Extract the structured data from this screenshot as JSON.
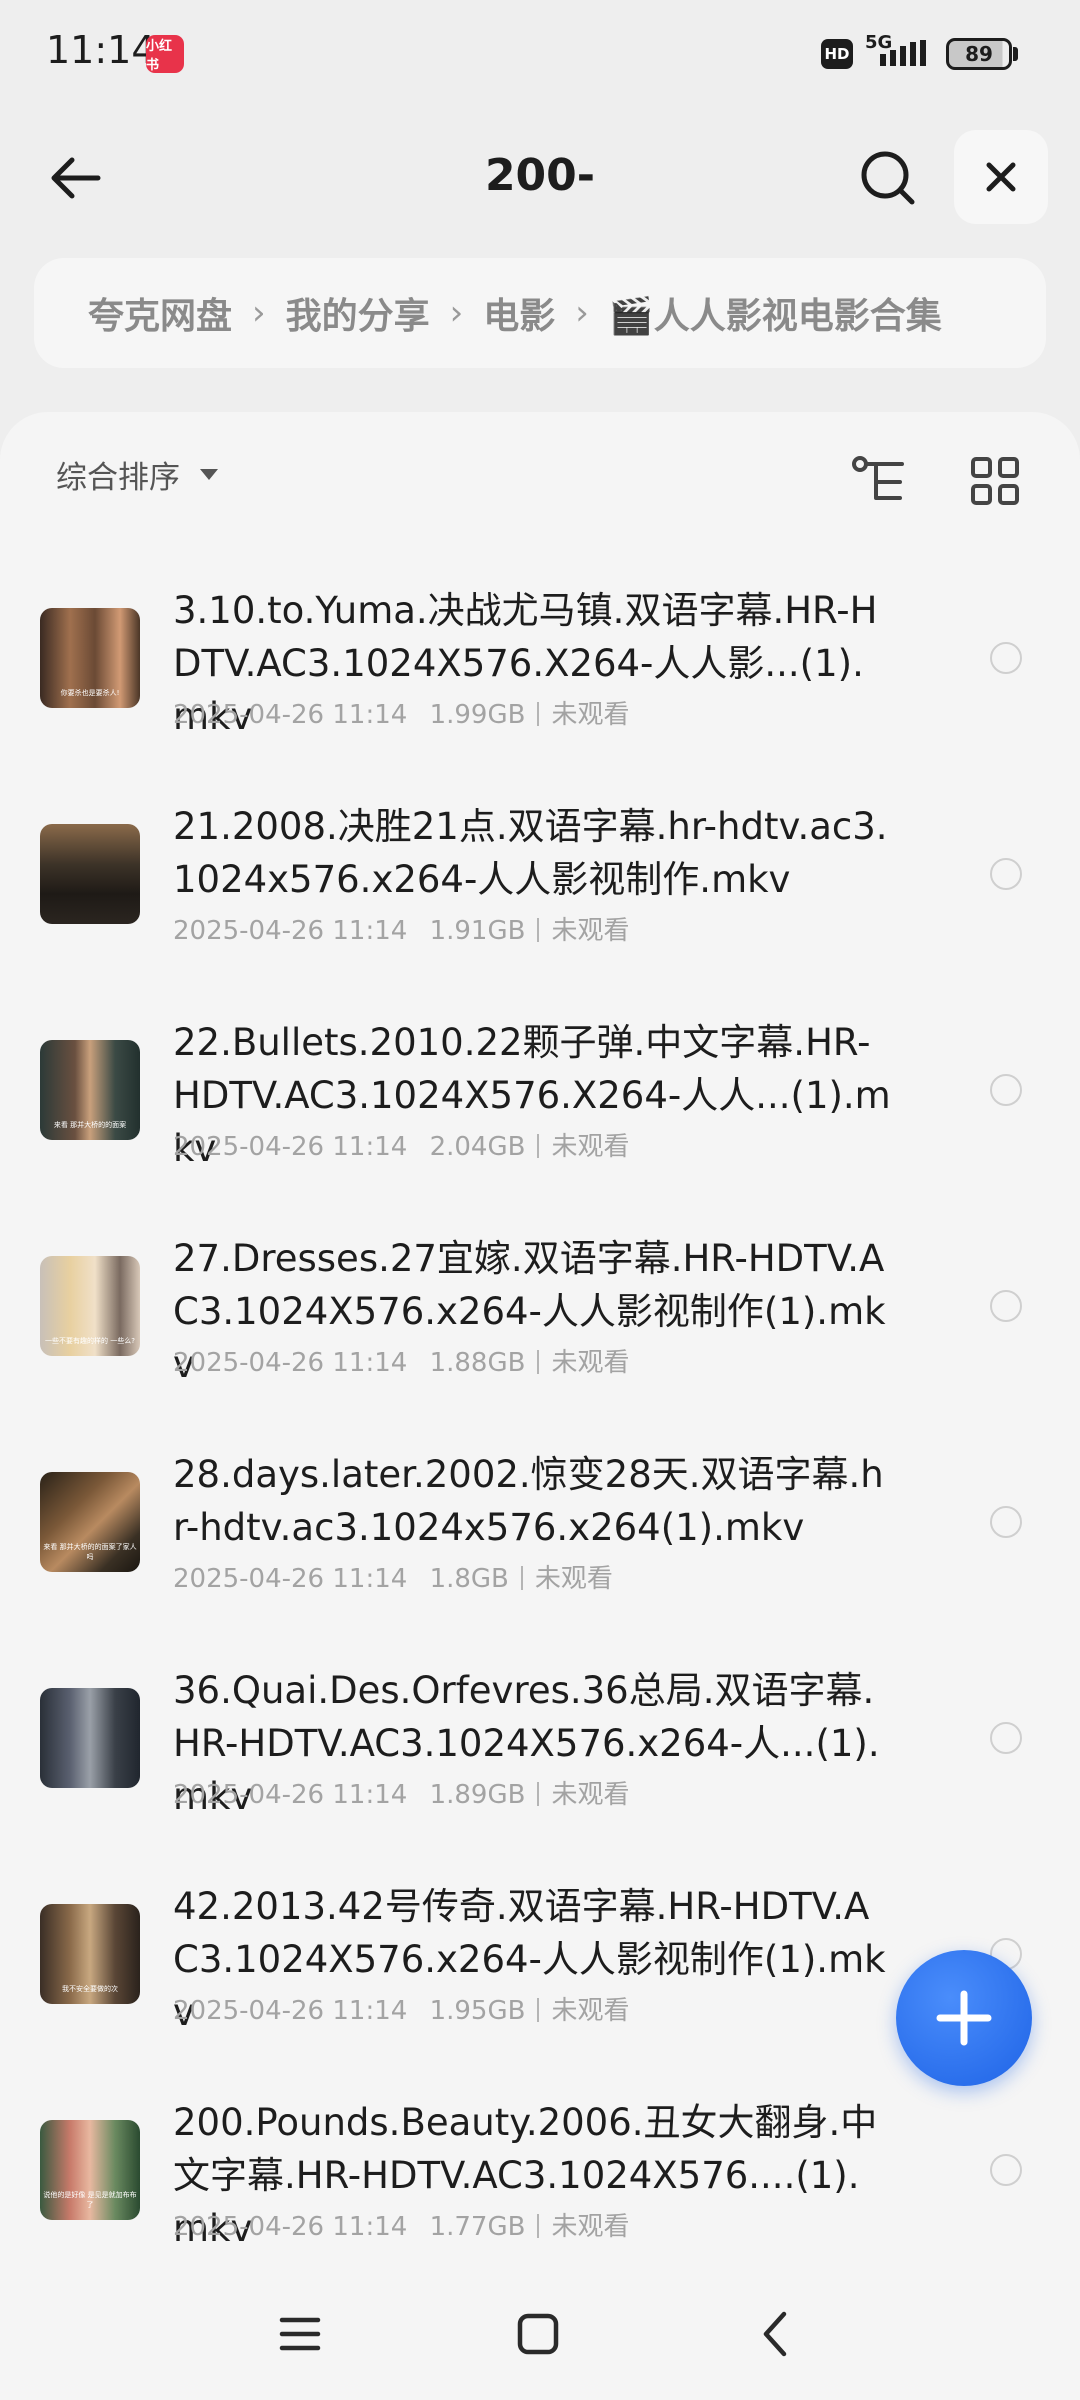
{
  "status_bar": {
    "time": "11:14",
    "app_badge": "小红书",
    "hd": "HD",
    "network": "5G",
    "battery": "89"
  },
  "header": {
    "title": "200-"
  },
  "breadcrumb": {
    "items": [
      "夸克网盘",
      "我的分享",
      "电影",
      "🎬人人影视电影合集"
    ]
  },
  "toolbar": {
    "sort_label": "综合排序"
  },
  "files": [
    {
      "name": "3.10.to.Yuma.决战尤马镇.双语字幕.HR-HDTV.AC3.1024X576.X264-人人影...(1).mkv",
      "date": "2025-04-26 11:14",
      "size": "1.99GB",
      "status": "未观看",
      "thumb_caption": "你要杀也是要杀人!"
    },
    {
      "name": "21.2008.决胜21点.双语字幕.hr-hdtv.ac3.1024x576.x264-人人影视制作.mkv",
      "date": "2025-04-26 11:14",
      "size": "1.91GB",
      "status": "未观看",
      "thumb_caption": ""
    },
    {
      "name": "22.Bullets.2010.22颗子弹.中文字幕.HR-HDTV.AC3.1024X576.X264-人人...(1).mkv",
      "date": "2025-04-26 11:14",
      "size": "2.04GB",
      "status": "未观看",
      "thumb_caption": "来看 那并大桥的的面案"
    },
    {
      "name": "27.Dresses.27宜嫁.双语字幕.HR-HDTV.AC3.1024X576.x264-人人影视制作(1).mkv",
      "date": "2025-04-26 11:14",
      "size": "1.88GB",
      "status": "未观看",
      "thumb_caption": "一些不要有趣的样的 一些么?"
    },
    {
      "name": "28.days.later.2002.惊变28天.双语字幕.hr-hdtv.ac3.1024x576.x264(1).mkv",
      "date": "2025-04-26 11:14",
      "size": "1.8GB",
      "status": "未观看",
      "thumb_caption": "来看 那并大桥的的面案了家人吗"
    },
    {
      "name": "36.Quai.Des.Orfevres.36总局.双语字幕.HR-HDTV.AC3.1024X576.x264-人...(1).mkv",
      "date": "2025-04-26 11:14",
      "size": "1.89GB",
      "status": "未观看",
      "thumb_caption": ""
    },
    {
      "name": "42.2013.42号传奇.双语字幕.HR-HDTV.AC3.1024X576.x264-人人影视制作(1).mkv",
      "date": "2025-04-26 11:14",
      "size": "1.95GB",
      "status": "未观看",
      "thumb_caption": "我不安全要做的次"
    },
    {
      "name": "200.Pounds.Beauty.2006.丑女大翻身.中文字幕.HR-HDTV.AC3.1024X576....(1).mkv",
      "date": "2025-04-26 11:14",
      "size": "1.77GB",
      "status": "未观看",
      "thumb_caption": "说他的是好像 是见是就加布布了"
    }
  ],
  "colors": {
    "accent": "#1e63e6",
    "background": "#eeeeee",
    "panel": "#f5f5f5",
    "meta_text": "#a3a3a3"
  },
  "icons": {
    "back": "arrow-left-icon",
    "search": "search-icon",
    "close": "close-icon",
    "tree": "tree-view-icon",
    "grid": "grid-view-icon",
    "fab": "plus-icon",
    "nav_menu": "menu-icon",
    "nav_home": "home-square-icon",
    "nav_back": "chevron-left-icon"
  }
}
